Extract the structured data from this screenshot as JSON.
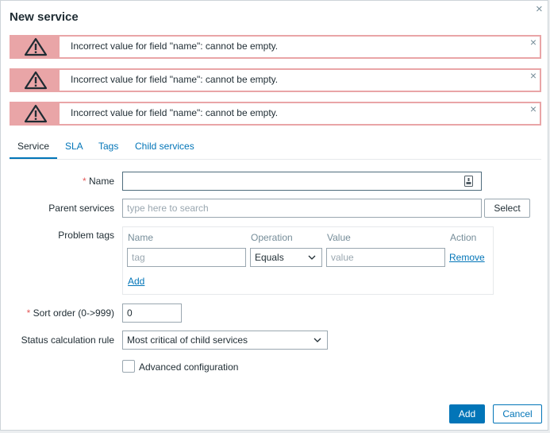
{
  "dialog": {
    "title": "New service",
    "close_glyph": "×"
  },
  "alerts": [
    {
      "message": "Incorrect value for field \"name\": cannot be empty.",
      "icon": "warning-icon"
    },
    {
      "message": "Incorrect value for field \"name\": cannot be empty.",
      "icon": "warning-icon"
    },
    {
      "message": "Incorrect value for field \"name\": cannot be empty.",
      "icon": "warning-icon"
    }
  ],
  "alert_close_glyph": "×",
  "tabs": [
    {
      "label": "Service",
      "active": true
    },
    {
      "label": "SLA"
    },
    {
      "label": "Tags"
    },
    {
      "label": "Child services"
    }
  ],
  "form": {
    "name_label": "Name",
    "name_value": "",
    "parent_label": "Parent services",
    "parent_placeholder": "type here to search",
    "select_button": "Select",
    "problem_tags_label": "Problem tags",
    "problem_tags": {
      "headers": [
        "Name",
        "Operation",
        "Value",
        "Action"
      ],
      "row": {
        "tag_placeholder": "tag",
        "operation": "Equals",
        "value_placeholder": "value",
        "remove": "Remove"
      },
      "add_link": "Add"
    },
    "sort_order_label": "Sort order (0->999)",
    "sort_order_value": "0",
    "status_rule_label": "Status calculation rule",
    "status_rule_value": "Most critical of child services",
    "advanced_config_label": "Advanced configuration",
    "required_mark": "*"
  },
  "footer": {
    "add_button": "Add",
    "cancel_button": "Cancel"
  },
  "colors": {
    "accent": "#0275b8",
    "alert_border": "#e9a5a7",
    "required": "#e45959"
  }
}
